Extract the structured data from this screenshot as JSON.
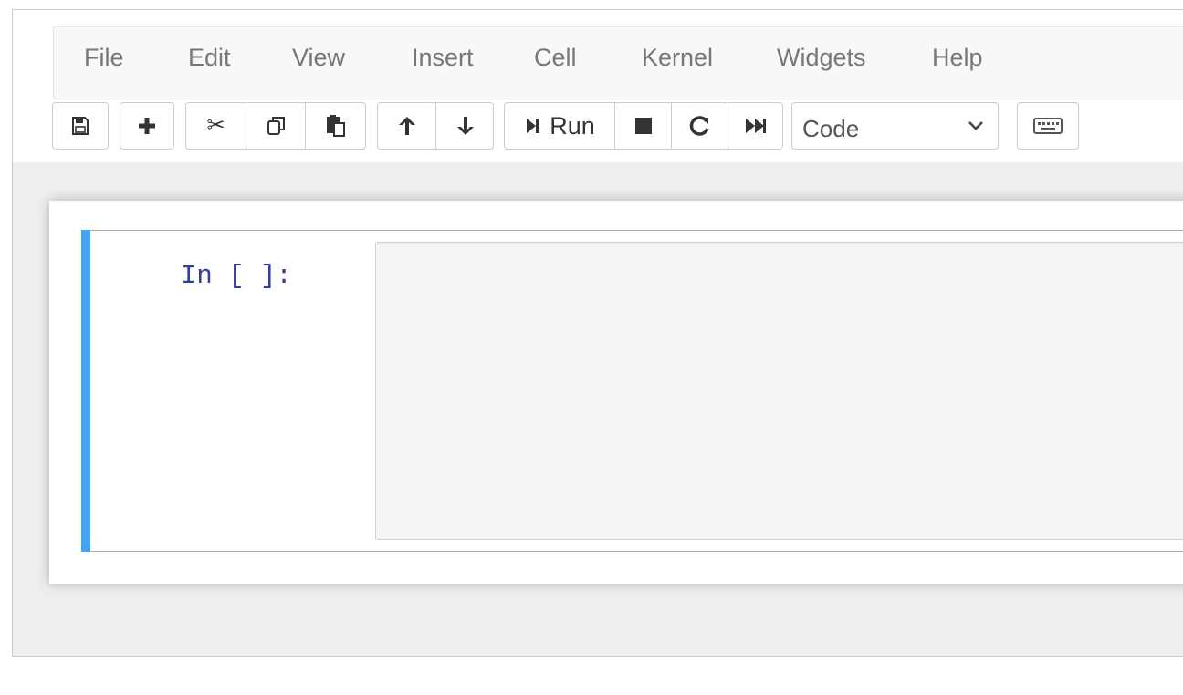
{
  "menubar": {
    "items": [
      "File",
      "Edit",
      "View",
      "Insert",
      "Cell",
      "Kernel",
      "Widgets",
      "Help"
    ]
  },
  "toolbar": {
    "run_label": "Run",
    "icons": {
      "save": "save-icon",
      "insert": "plus-icon",
      "cut": "scissors-icon",
      "copy": "copy-icon",
      "paste": "paste-icon",
      "move_up": "arrow-up-icon",
      "move_down": "arrow-down-icon",
      "run": "step-forward-icon",
      "interrupt": "stop-icon",
      "restart": "redo-icon",
      "restart_run_all": "fast-forward-icon",
      "command_palette": "keyboard-icon"
    },
    "cell_type": {
      "selected": "Code"
    }
  },
  "cell": {
    "prompt": "In [ ]:",
    "accent_color": "#42a5f5"
  }
}
